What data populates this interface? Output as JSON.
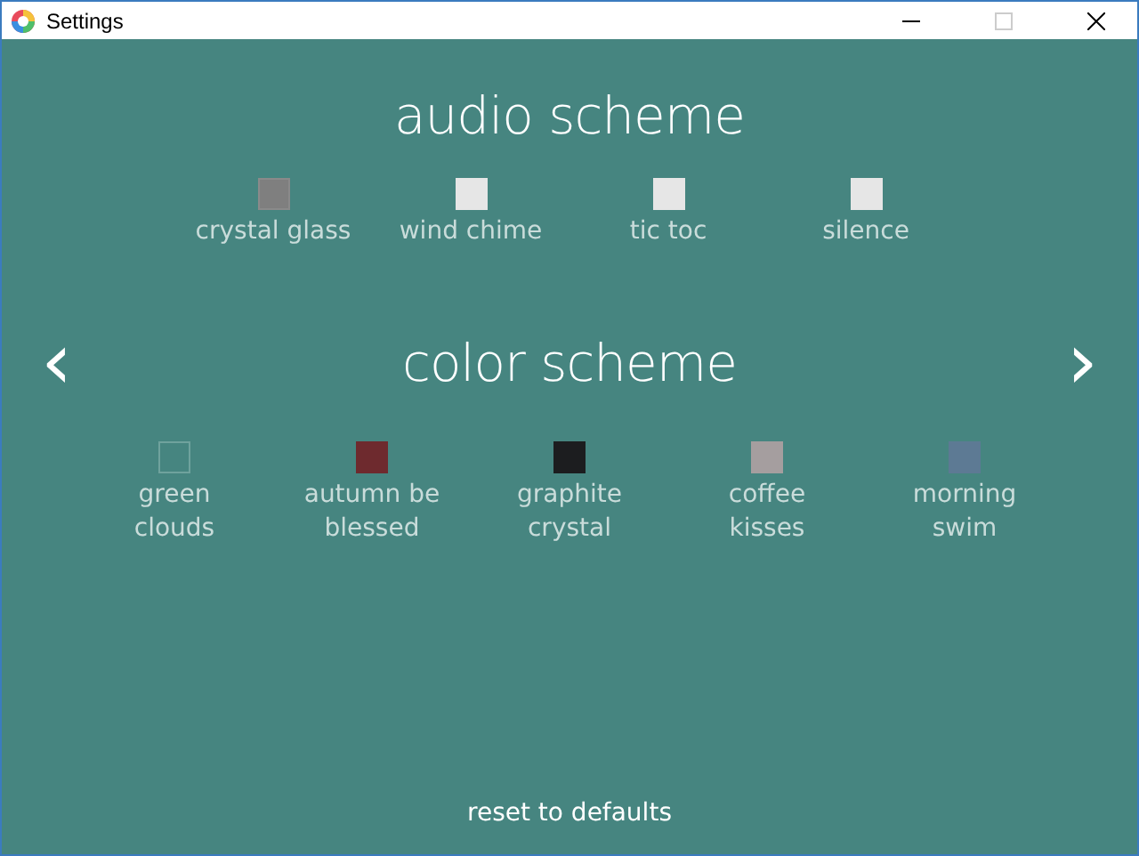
{
  "window": {
    "title": "Settings"
  },
  "audio_scheme": {
    "title": "audio scheme",
    "items": [
      {
        "label": "crystal glass",
        "selected": true
      },
      {
        "label": "wind chime",
        "selected": false
      },
      {
        "label": "tic toc",
        "selected": false
      },
      {
        "label": "silence",
        "selected": false
      }
    ]
  },
  "color_scheme": {
    "title": "color scheme",
    "prev": "‹",
    "next": "›",
    "items": [
      {
        "label": "green\nclouds",
        "color": "#468580",
        "selected": true
      },
      {
        "label": "autumn be\nblessed",
        "color": "#6e2a2e",
        "selected": false
      },
      {
        "label": "graphite\ncrystal",
        "color": "#1c1d1f",
        "selected": false
      },
      {
        "label": "coffee\nkisses",
        "color": "#a59e9f",
        "selected": false
      },
      {
        "label": "morning\nswim",
        "color": "#5d7a94",
        "selected": false
      }
    ]
  },
  "reset": "reset to defaults"
}
